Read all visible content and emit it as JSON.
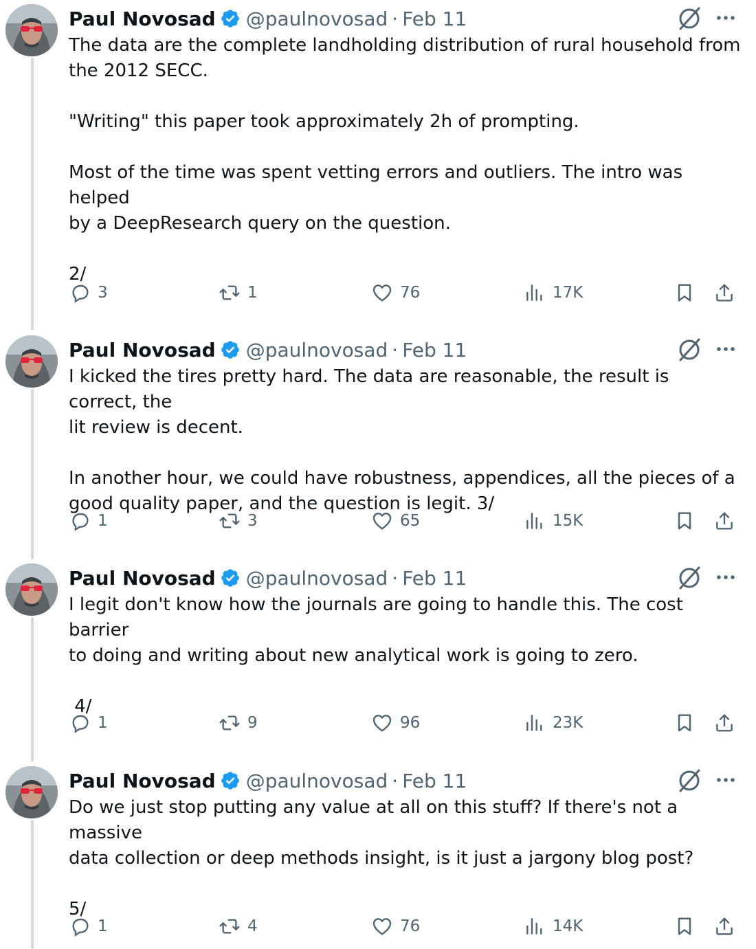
{
  "tweets": [
    {
      "name": "Paul Novosad",
      "handle": "@paulnovosad",
      "separator": "·",
      "date": "Feb 11",
      "text": "The data are the complete landholding distribution of rural household from\nthe 2012 SECC.\n\n\"Writing\" this paper took approximately 2h of prompting.\n\nMost of the time was spent vetting errors and outliers. The intro was helped\nby a DeepResearch query on the question.\n\n2/",
      "replies": "3",
      "retweets": "1",
      "likes": "76",
      "views": "17K"
    },
    {
      "name": "Paul Novosad",
      "handle": "@paulnovosad",
      "separator": "·",
      "date": "Feb 11",
      "text": "I kicked the tires pretty hard. The data are reasonable, the result is correct, the\nlit review is decent.\n\nIn another hour, we could have robustness, appendices, all the pieces of a\ngood quality paper, and the question is legit. 3/",
      "replies": "1",
      "retweets": "3",
      "likes": "65",
      "views": "15K"
    },
    {
      "name": "Paul Novosad",
      "handle": "@paulnovosad",
      "separator": "·",
      "date": "Feb 11",
      "text": "I legit don't know how the journals are going to handle this. The cost barrier\nto doing and writing about new analytical work is going to zero.\n\n 4/",
      "replies": "1",
      "retweets": "9",
      "likes": "96",
      "views": "23K"
    },
    {
      "name": "Paul Novosad",
      "handle": "@paulnovosad",
      "separator": "·",
      "date": "Feb 11",
      "text": "Do we just stop putting any value at all on this stuff? If there's not a massive\ndata collection or deep methods insight, is it just a jargony blog post?\n\n5/",
      "replies": "1",
      "retweets": "4",
      "likes": "76",
      "views": "14K"
    }
  ],
  "icons": {
    "verified": "verified-badge-icon",
    "grok": "grok-icon",
    "more": "more-icon",
    "reply": "reply-icon",
    "retweet": "retweet-icon",
    "like": "heart-icon",
    "views": "views-icon",
    "bookmark": "bookmark-icon",
    "share": "share-icon"
  },
  "colors": {
    "verified": "#1d9bf0",
    "text": "#0f1419",
    "secondary": "#536471",
    "thread_line": "#cfd9de"
  }
}
